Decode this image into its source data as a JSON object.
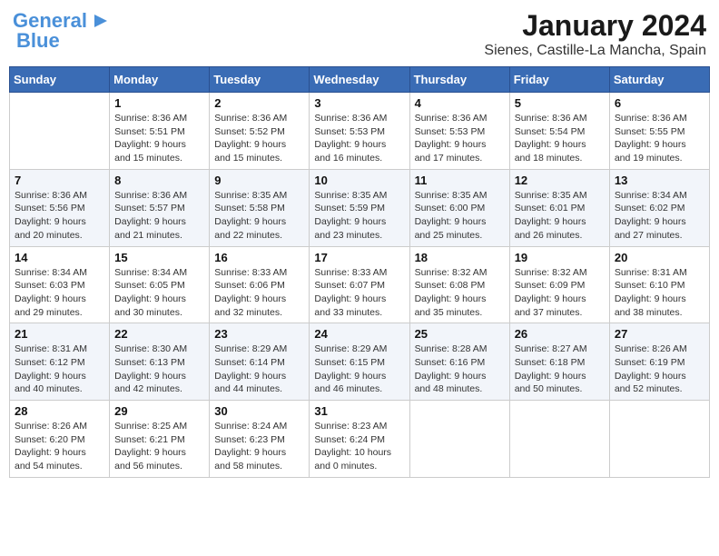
{
  "header": {
    "logo_line1": "General",
    "logo_line2": "Blue",
    "title": "January 2024",
    "subtitle": "Sienes, Castille-La Mancha, Spain"
  },
  "columns": [
    "Sunday",
    "Monday",
    "Tuesday",
    "Wednesday",
    "Thursday",
    "Friday",
    "Saturday"
  ],
  "weeks": [
    [
      {
        "day": "",
        "empty": true
      },
      {
        "day": "1",
        "sunrise": "Sunrise: 8:36 AM",
        "sunset": "Sunset: 5:51 PM",
        "daylight": "Daylight: 9 hours and 15 minutes."
      },
      {
        "day": "2",
        "sunrise": "Sunrise: 8:36 AM",
        "sunset": "Sunset: 5:52 PM",
        "daylight": "Daylight: 9 hours and 15 minutes."
      },
      {
        "day": "3",
        "sunrise": "Sunrise: 8:36 AM",
        "sunset": "Sunset: 5:53 PM",
        "daylight": "Daylight: 9 hours and 16 minutes."
      },
      {
        "day": "4",
        "sunrise": "Sunrise: 8:36 AM",
        "sunset": "Sunset: 5:53 PM",
        "daylight": "Daylight: 9 hours and 17 minutes."
      },
      {
        "day": "5",
        "sunrise": "Sunrise: 8:36 AM",
        "sunset": "Sunset: 5:54 PM",
        "daylight": "Daylight: 9 hours and 18 minutes."
      },
      {
        "day": "6",
        "sunrise": "Sunrise: 8:36 AM",
        "sunset": "Sunset: 5:55 PM",
        "daylight": "Daylight: 9 hours and 19 minutes."
      }
    ],
    [
      {
        "day": "7",
        "sunrise": "Sunrise: 8:36 AM",
        "sunset": "Sunset: 5:56 PM",
        "daylight": "Daylight: 9 hours and 20 minutes."
      },
      {
        "day": "8",
        "sunrise": "Sunrise: 8:36 AM",
        "sunset": "Sunset: 5:57 PM",
        "daylight": "Daylight: 9 hours and 21 minutes."
      },
      {
        "day": "9",
        "sunrise": "Sunrise: 8:35 AM",
        "sunset": "Sunset: 5:58 PM",
        "daylight": "Daylight: 9 hours and 22 minutes."
      },
      {
        "day": "10",
        "sunrise": "Sunrise: 8:35 AM",
        "sunset": "Sunset: 5:59 PM",
        "daylight": "Daylight: 9 hours and 23 minutes."
      },
      {
        "day": "11",
        "sunrise": "Sunrise: 8:35 AM",
        "sunset": "Sunset: 6:00 PM",
        "daylight": "Daylight: 9 hours and 25 minutes."
      },
      {
        "day": "12",
        "sunrise": "Sunrise: 8:35 AM",
        "sunset": "Sunset: 6:01 PM",
        "daylight": "Daylight: 9 hours and 26 minutes."
      },
      {
        "day": "13",
        "sunrise": "Sunrise: 8:34 AM",
        "sunset": "Sunset: 6:02 PM",
        "daylight": "Daylight: 9 hours and 27 minutes."
      }
    ],
    [
      {
        "day": "14",
        "sunrise": "Sunrise: 8:34 AM",
        "sunset": "Sunset: 6:03 PM",
        "daylight": "Daylight: 9 hours and 29 minutes."
      },
      {
        "day": "15",
        "sunrise": "Sunrise: 8:34 AM",
        "sunset": "Sunset: 6:05 PM",
        "daylight": "Daylight: 9 hours and 30 minutes."
      },
      {
        "day": "16",
        "sunrise": "Sunrise: 8:33 AM",
        "sunset": "Sunset: 6:06 PM",
        "daylight": "Daylight: 9 hours and 32 minutes."
      },
      {
        "day": "17",
        "sunrise": "Sunrise: 8:33 AM",
        "sunset": "Sunset: 6:07 PM",
        "daylight": "Daylight: 9 hours and 33 minutes."
      },
      {
        "day": "18",
        "sunrise": "Sunrise: 8:32 AM",
        "sunset": "Sunset: 6:08 PM",
        "daylight": "Daylight: 9 hours and 35 minutes."
      },
      {
        "day": "19",
        "sunrise": "Sunrise: 8:32 AM",
        "sunset": "Sunset: 6:09 PM",
        "daylight": "Daylight: 9 hours and 37 minutes."
      },
      {
        "day": "20",
        "sunrise": "Sunrise: 8:31 AM",
        "sunset": "Sunset: 6:10 PM",
        "daylight": "Daylight: 9 hours and 38 minutes."
      }
    ],
    [
      {
        "day": "21",
        "sunrise": "Sunrise: 8:31 AM",
        "sunset": "Sunset: 6:12 PM",
        "daylight": "Daylight: 9 hours and 40 minutes."
      },
      {
        "day": "22",
        "sunrise": "Sunrise: 8:30 AM",
        "sunset": "Sunset: 6:13 PM",
        "daylight": "Daylight: 9 hours and 42 minutes."
      },
      {
        "day": "23",
        "sunrise": "Sunrise: 8:29 AM",
        "sunset": "Sunset: 6:14 PM",
        "daylight": "Daylight: 9 hours and 44 minutes."
      },
      {
        "day": "24",
        "sunrise": "Sunrise: 8:29 AM",
        "sunset": "Sunset: 6:15 PM",
        "daylight": "Daylight: 9 hours and 46 minutes."
      },
      {
        "day": "25",
        "sunrise": "Sunrise: 8:28 AM",
        "sunset": "Sunset: 6:16 PM",
        "daylight": "Daylight: 9 hours and 48 minutes."
      },
      {
        "day": "26",
        "sunrise": "Sunrise: 8:27 AM",
        "sunset": "Sunset: 6:18 PM",
        "daylight": "Daylight: 9 hours and 50 minutes."
      },
      {
        "day": "27",
        "sunrise": "Sunrise: 8:26 AM",
        "sunset": "Sunset: 6:19 PM",
        "daylight": "Daylight: 9 hours and 52 minutes."
      }
    ],
    [
      {
        "day": "28",
        "sunrise": "Sunrise: 8:26 AM",
        "sunset": "Sunset: 6:20 PM",
        "daylight": "Daylight: 9 hours and 54 minutes."
      },
      {
        "day": "29",
        "sunrise": "Sunrise: 8:25 AM",
        "sunset": "Sunset: 6:21 PM",
        "daylight": "Daylight: 9 hours and 56 minutes."
      },
      {
        "day": "30",
        "sunrise": "Sunrise: 8:24 AM",
        "sunset": "Sunset: 6:23 PM",
        "daylight": "Daylight: 9 hours and 58 minutes."
      },
      {
        "day": "31",
        "sunrise": "Sunrise: 8:23 AM",
        "sunset": "Sunset: 6:24 PM",
        "daylight": "Daylight: 10 hours and 0 minutes."
      },
      {
        "day": "",
        "empty": true
      },
      {
        "day": "",
        "empty": true
      },
      {
        "day": "",
        "empty": true
      }
    ]
  ]
}
